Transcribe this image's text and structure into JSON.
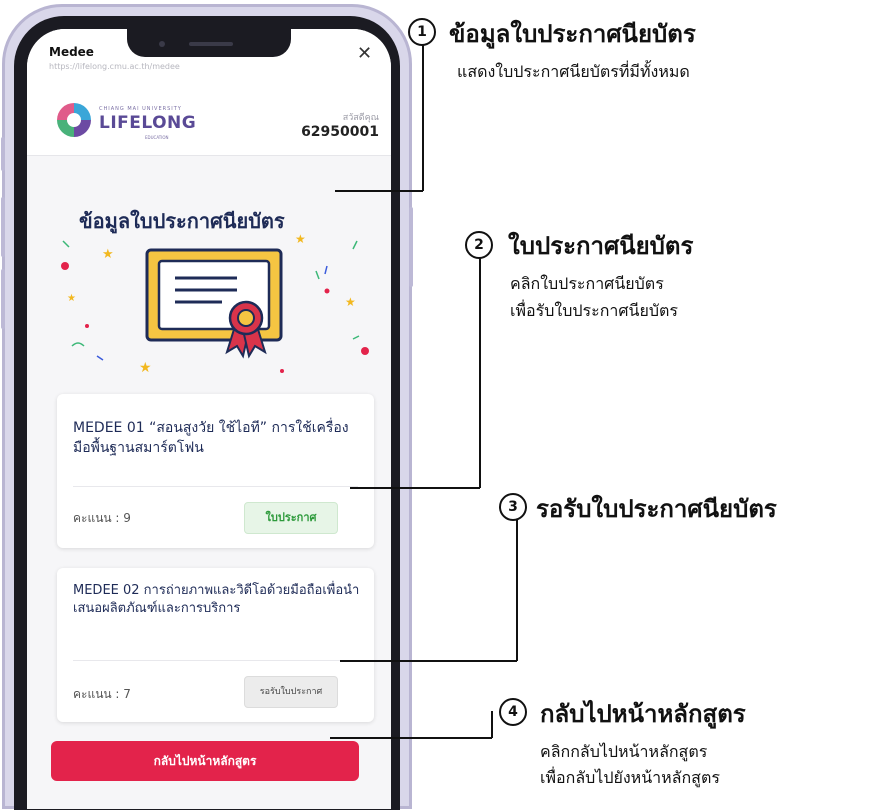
{
  "app_bar": {
    "title": "Medee",
    "url": "https://lifelong.cmu.ac.th/medee",
    "close_symbol": "✕"
  },
  "header": {
    "logo_small_text": "CHIANG MAI UNIVERSITY",
    "logo_text": "LIFELONG",
    "logo_sub_text": "EDUCATION",
    "greeting": "สวัสดีคุณ",
    "user_id": "62950001"
  },
  "page": {
    "title": "ข้อมูลใบประกาศนียบัตร"
  },
  "courses": [
    {
      "title": "MEDEE 01 “สอนสูงวัย ใช้ไอที” การใช้เครื่องมือพื้นฐานสมาร์ตโฟน",
      "score": "คะแนน : 9",
      "button_label": "ใบประกาศ"
    },
    {
      "title": "MEDEE 02 การถ่ายภาพและวิดีโอด้วยมือถือเพื่อนำเสนอผลิตภัณฑ์และการบริการ",
      "score": "คะแนน : 7",
      "button_label": "รอรับใบประกาศ"
    }
  ],
  "back_button_label": "กลับไปหน้าหลักสูตร",
  "annotations": [
    {
      "number": "1",
      "title": "ข้อมูลใบประกาศนียบัตร",
      "desc": [
        "แสดงใบประกาศนียบัตรที่มีทั้งหมด"
      ]
    },
    {
      "number": "2",
      "title": "ใบประกาศนียบัตร",
      "desc": [
        "คลิกใบประกาศนียบัตร",
        "เพื่อรับใบประกาศนียบัตร"
      ]
    },
    {
      "number": "3",
      "title": "รอรับใบประกาศนียบัตร",
      "desc": []
    },
    {
      "number": "4",
      "title": "กลับไปหน้าหลักสูตร",
      "desc": [
        "คลิกกลับไปหน้าหลักสูตร",
        "เพื่อกลับไปยังหน้าหลักสูตร"
      ]
    }
  ],
  "colors": {
    "accent_red": "#e3234b",
    "title_navy": "#1e2b57",
    "cert_gold": "#f5c542",
    "ribbon_red": "#d9344a",
    "cert_button_green": "#2d9a3b"
  },
  "icons": {
    "close": "close-icon",
    "logo": "lifelong-logo-icon",
    "certificate": "certificate-illustration"
  }
}
